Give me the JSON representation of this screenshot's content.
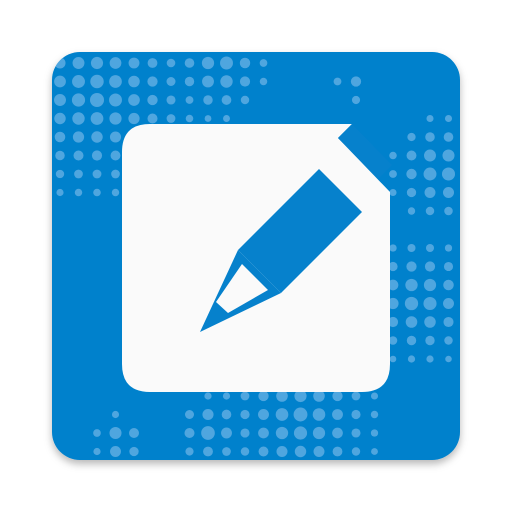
{
  "icon": {
    "name": "notepad-pencil-app-icon",
    "background_color": "#0681cc",
    "dot_color": "#4fa6df",
    "paper_color": "#fafafa",
    "pencil_color": "#0681cc"
  }
}
